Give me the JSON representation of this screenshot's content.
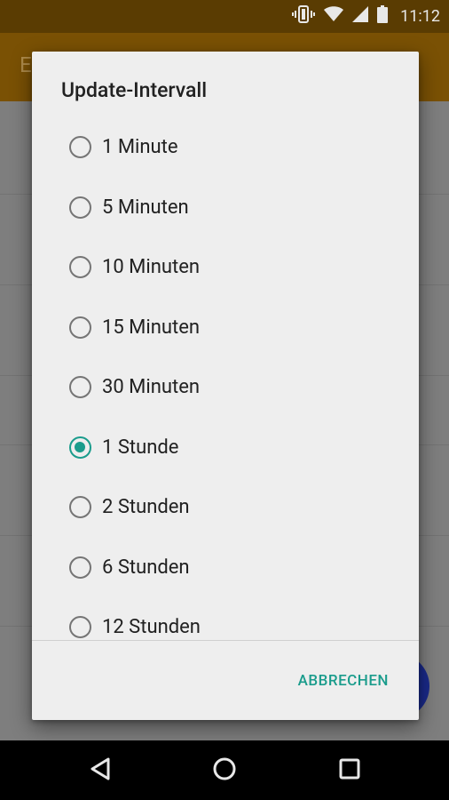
{
  "status_bar": {
    "time": "11:12"
  },
  "app_bar": {
    "title_fragment": "E"
  },
  "dialog": {
    "title": "Update-Intervall",
    "options": [
      {
        "label": "1 Minute",
        "selected": false
      },
      {
        "label": "5 Minuten",
        "selected": false
      },
      {
        "label": "10 Minuten",
        "selected": false
      },
      {
        "label": "15 Minuten",
        "selected": false
      },
      {
        "label": "30 Minuten",
        "selected": false
      },
      {
        "label": "1 Stunde",
        "selected": true
      },
      {
        "label": "2 Stunden",
        "selected": false
      },
      {
        "label": "6 Stunden",
        "selected": false
      },
      {
        "label": "12 Stunden",
        "selected": false
      }
    ],
    "cancel_label": "ABBRECHEN"
  },
  "colors": {
    "accent": "#1a9c8c",
    "status_bar": "#5a3c02",
    "app_bar_dimmed": "#7a5104",
    "fab": "#1a2a8a"
  },
  "icons": {
    "status": [
      "vibrate-icon",
      "wifi-icon",
      "cell-signal-icon",
      "battery-icon"
    ],
    "navigation": [
      "back-icon",
      "home-icon",
      "recents-icon"
    ]
  }
}
